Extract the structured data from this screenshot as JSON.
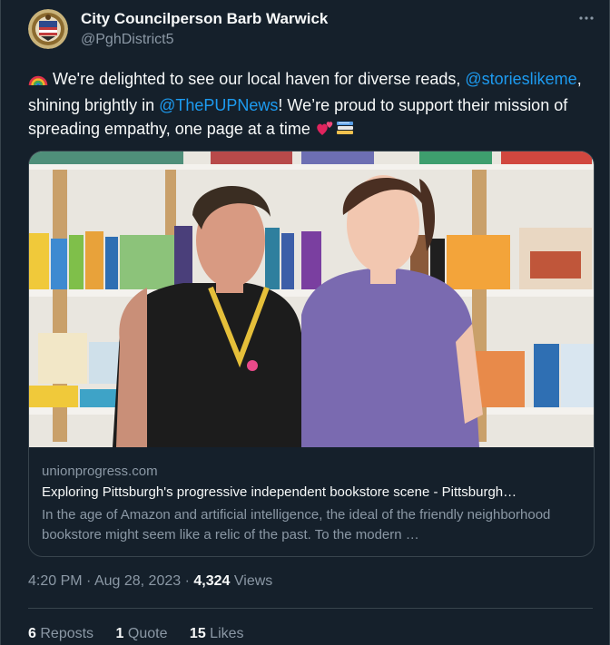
{
  "author": {
    "display_name": "City Councilperson Barb Warwick",
    "handle": "@PghDistrict5",
    "avatar_icon": "city-seal-icon"
  },
  "more_icon": "more-options-icon",
  "tweet": {
    "segments": [
      {
        "type": "emoji",
        "icon": "rainbow-icon"
      },
      {
        "type": "text",
        "value": " We're delighted to see our local haven for diverse reads, "
      },
      {
        "type": "mention",
        "value": "@storieslikeme"
      },
      {
        "type": "text",
        "value": ", shining brightly in "
      },
      {
        "type": "mention",
        "value": "@ThePUPNews"
      },
      {
        "type": "text",
        "value": "! We’re proud to support their mission of spreading empathy, one page at a time "
      },
      {
        "type": "emoji",
        "icon": "hearts-icon"
      },
      {
        "type": "emoji",
        "icon": "books-icon"
      }
    ]
  },
  "card": {
    "image_alt": "Two women smiling in front of bookshelves",
    "domain": "unionprogress.com",
    "title": "Exploring Pittsburgh's progressive independent bookstore scene - Pittsburgh…",
    "description": "In the age of Amazon and artificial intelligence, the ideal of the friendly neighborhood bookstore might seem like a relic of the past. To the modern …"
  },
  "meta": {
    "time": "4:20 PM",
    "date": "Aug 28, 2023",
    "views_count": "4,324",
    "views_label": "Views",
    "sep": "·"
  },
  "stats": [
    {
      "count": "6",
      "label": "Reposts"
    },
    {
      "count": "1",
      "label": "Quote"
    },
    {
      "count": "15",
      "label": "Likes"
    }
  ],
  "colors": {
    "background": "#15202b",
    "accent": "#1d9bf0",
    "muted": "#8b98a5",
    "border": "#38444d"
  }
}
